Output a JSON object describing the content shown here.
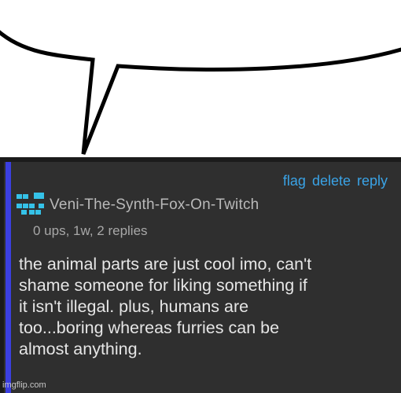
{
  "comment": {
    "actions": {
      "flag": "flag",
      "delete": "delete",
      "reply": "reply"
    },
    "username": "Veni-The-Synth-Fox-On-Twitch",
    "meta": "0 ups, 1w, 2 replies",
    "text_lines": [
      "the animal parts are just cool imo, can't",
      "shame someone for liking something if",
      "it isn't illegal. plus, humans are",
      "too...boring whereas furries can be",
      "almost anything."
    ]
  },
  "watermark": "imgflip.com",
  "colors": {
    "card_bg": "#2f2f2f",
    "accent": "#3b3fe0",
    "link": "#3aa3e6",
    "avatar": "#35c2e8"
  },
  "icons": {
    "avatar": "pixel-face-avatar-icon"
  }
}
